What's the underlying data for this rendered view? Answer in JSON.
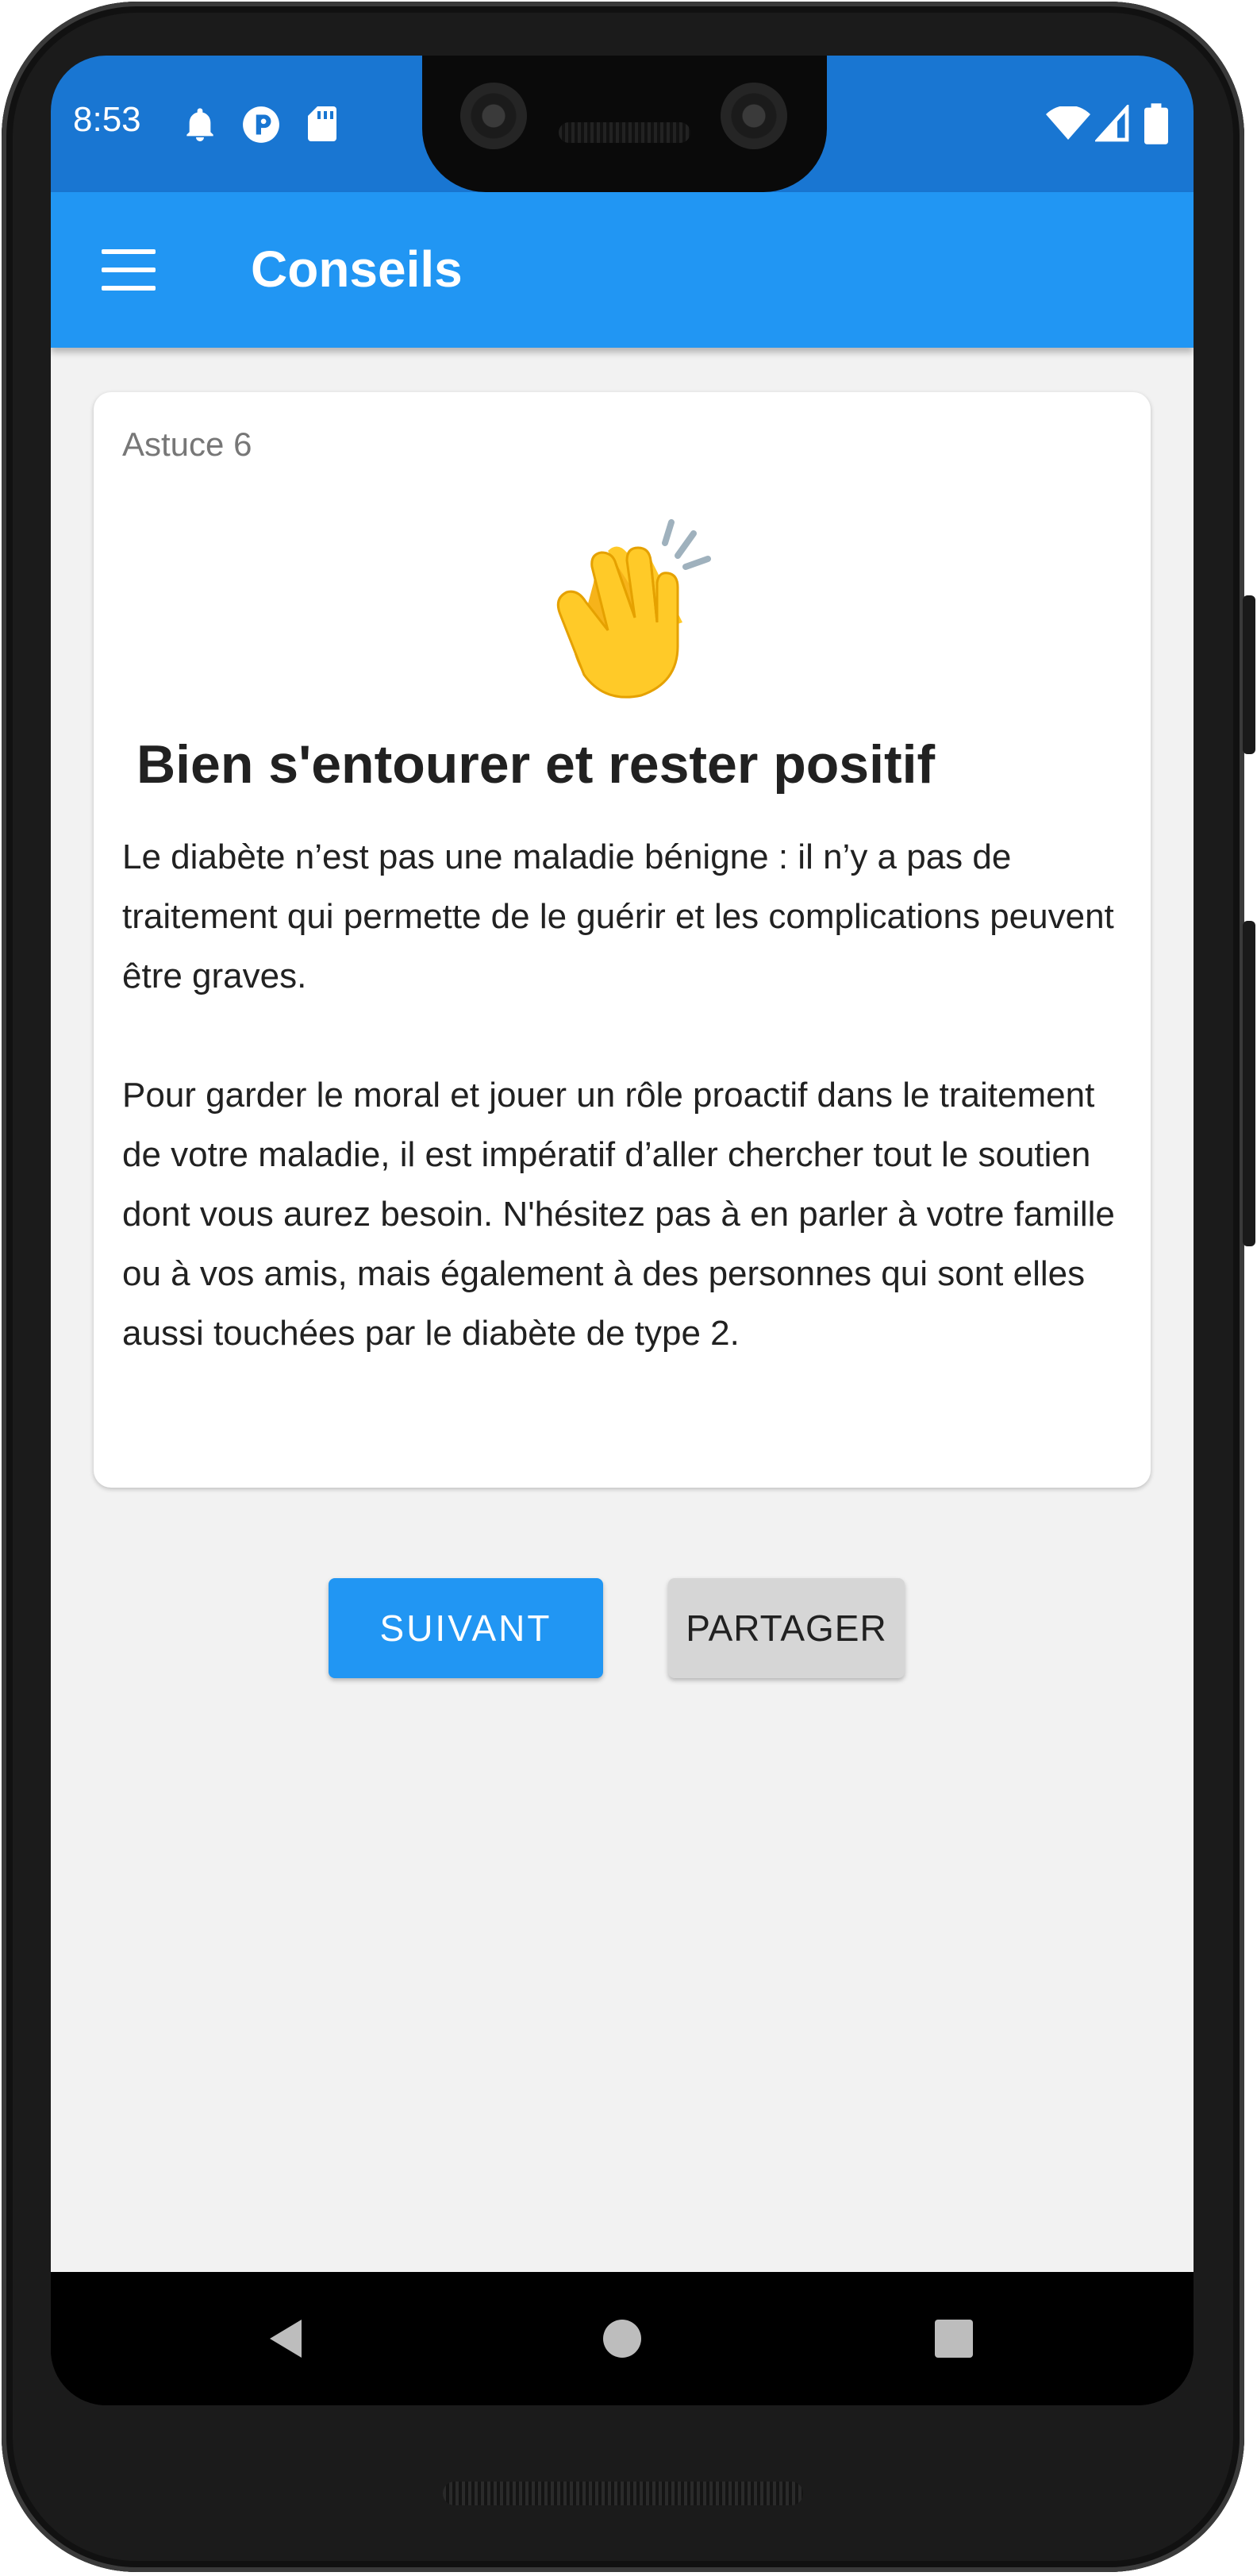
{
  "status_bar": {
    "time": "8:53",
    "icons": [
      "bell-icon",
      "app-badge-icon",
      "sd-card-icon",
      "wifi-icon",
      "cellular-signal-icon",
      "battery-icon"
    ],
    "color": "#1976d2"
  },
  "app_bar": {
    "menu_icon": "hamburger-menu-icon",
    "title": "Conseils",
    "color": "#2196f3"
  },
  "tip_card": {
    "overline": "Astuce 6",
    "emoji": "clapping-hands-icon",
    "title": "Bien s'entourer et rester positif",
    "paragraphs": [
      "Le diabète n’est pas une maladie bénigne : il n’y a pas de traitement qui permette de le guérir et les complications peuvent être graves.",
      "Pour garder le moral et jouer un rôle proactif dans le traitement de votre maladie, il est impératif d’aller chercher tout le soutien dont vous aurez besoin. N'hésitez pas à en parler à votre famille ou à vos amis, mais également à des personnes qui sont elles aussi touchées par le diabète de type 2."
    ]
  },
  "actions": {
    "next_label": "SUIVANT",
    "share_label": "PARTAGER"
  },
  "nav_bar": {
    "icons": [
      "back-icon",
      "home-icon",
      "recents-icon"
    ]
  }
}
